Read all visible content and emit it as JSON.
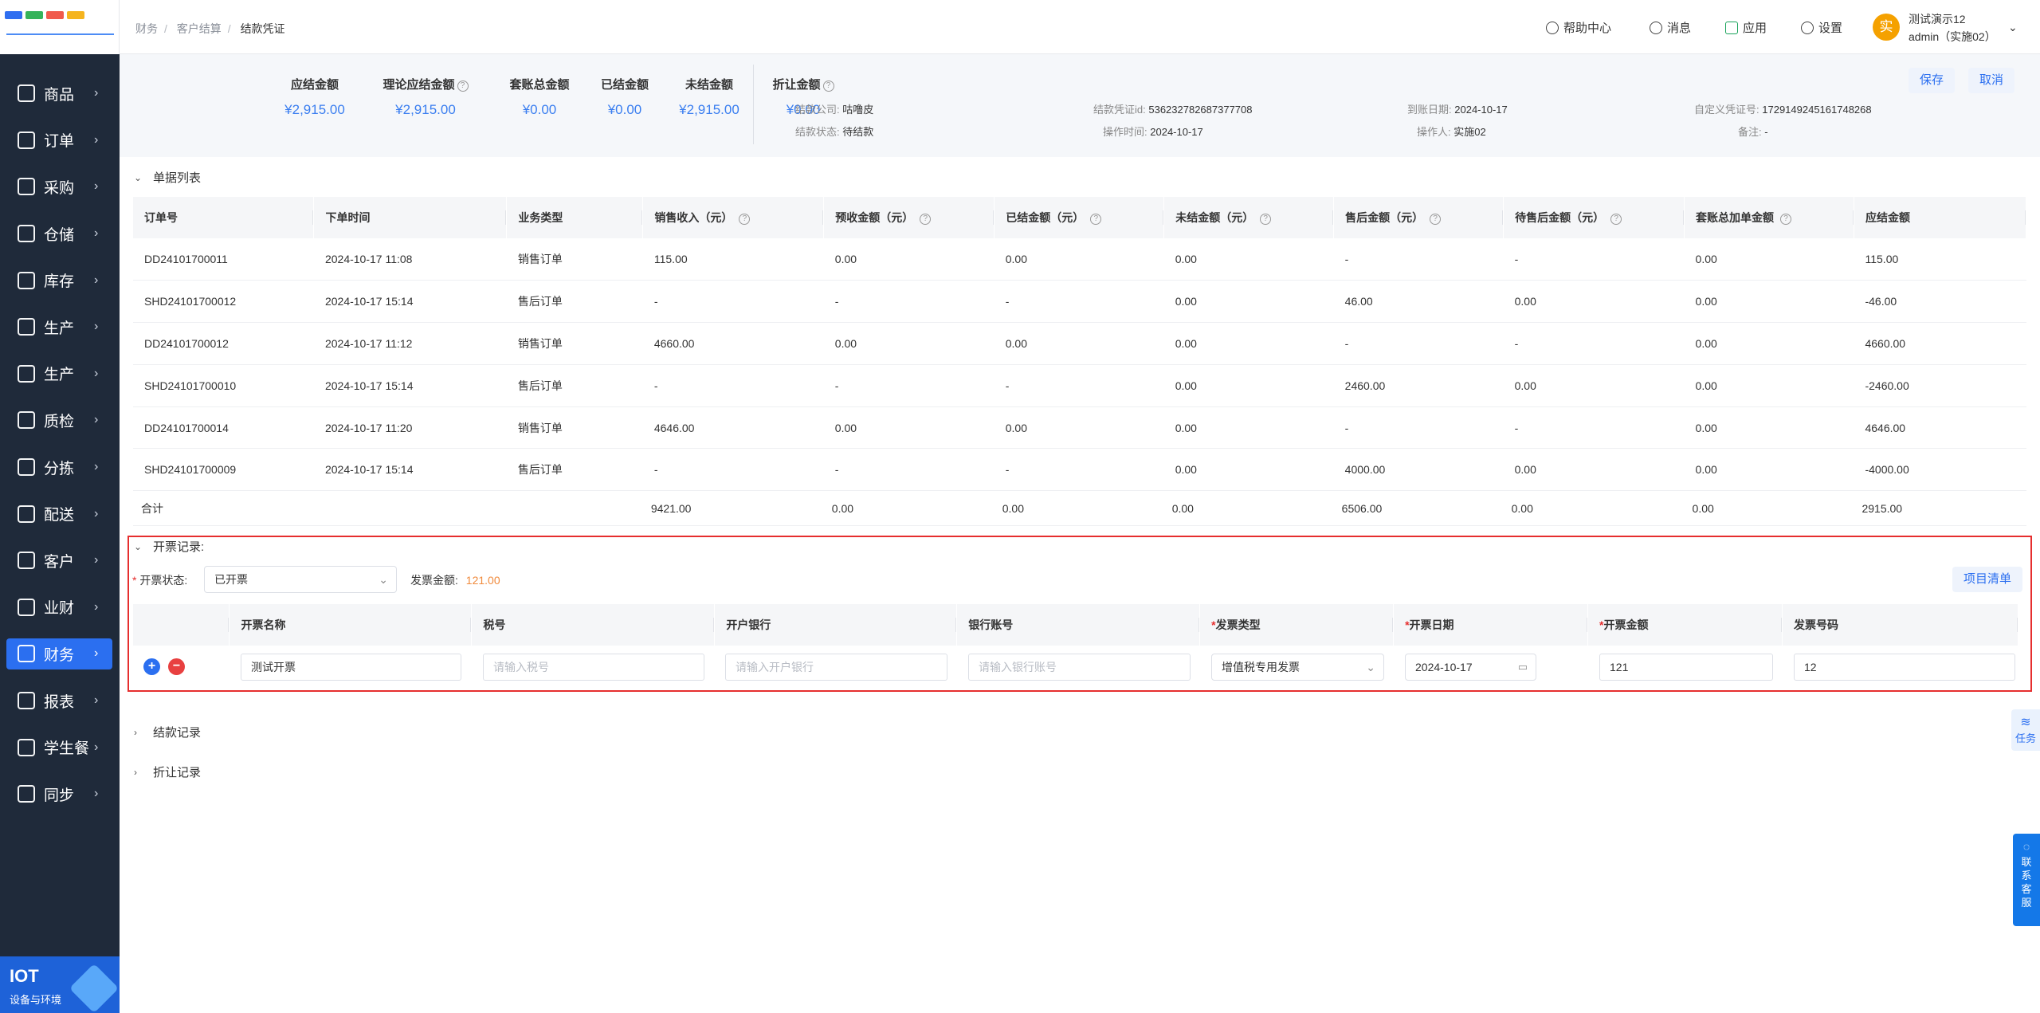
{
  "sidebar": {
    "logo_colors": [
      "#2f6ef0",
      "#35b35a",
      "#f05a4c",
      "#f5b41e"
    ],
    "items": [
      {
        "label": "商品",
        "icon": "goods-icon"
      },
      {
        "label": "订单",
        "icon": "order-icon"
      },
      {
        "label": "采购",
        "icon": "purchase-icon"
      },
      {
        "label": "仓储",
        "icon": "warehouse-icon"
      },
      {
        "label": "库存",
        "icon": "inventory-icon"
      },
      {
        "label": "生产",
        "icon": "production-icon"
      },
      {
        "label": "生产",
        "icon": "production-icon"
      },
      {
        "label": "质检",
        "icon": "shield-icon"
      },
      {
        "label": "分拣",
        "icon": "sorting-icon"
      },
      {
        "label": "配送",
        "icon": "truck-icon"
      },
      {
        "label": "客户",
        "icon": "customer-icon"
      },
      {
        "label": "业财",
        "icon": "chart-icon"
      },
      {
        "label": "财务",
        "icon": "finance-icon",
        "active": true
      },
      {
        "label": "报表",
        "icon": "report-icon"
      },
      {
        "label": "学生餐",
        "icon": "meal-icon"
      },
      {
        "label": "同步",
        "icon": "sync-icon"
      }
    ],
    "brand_title": "IOT",
    "brand_subtitle": "设备与环境"
  },
  "header": {
    "breadcrumb": [
      "财务",
      "客户结算",
      "结款凭证"
    ],
    "help": "帮助中心",
    "messages": "消息",
    "apps": "应用",
    "settings": "设置",
    "avatar_char": "实",
    "user_name": "测试演示12",
    "user_account": "admin（实施02）"
  },
  "summary": {
    "stats": [
      {
        "label": "应结金额",
        "value": "¥2,915.00",
        "help": false
      },
      {
        "label": "理论应结金额",
        "value": "¥2,915.00",
        "help": true
      },
      {
        "label": "套账总金额",
        "value": "¥0.00",
        "help": false
      },
      {
        "label": "已结金额",
        "value": "¥0.00",
        "help": false
      },
      {
        "label": "未结金额",
        "value": "¥2,915.00",
        "help": false
      },
      {
        "label": "折让金额",
        "value": "¥0.00",
        "help": true
      }
    ],
    "info": {
      "company_label": "结款公司:",
      "company": "咕噜皮",
      "status_label": "结款状态:",
      "status": "待结款",
      "voucher_label": "结款凭证id:",
      "voucher": "536232782687377708",
      "optime_label": "操作时间:",
      "optime": "2024-10-17",
      "arrive_label": "到账日期:",
      "arrive": "2024-10-17",
      "operator_label": "操作人:",
      "operator": "实施02",
      "custom_label": "自定义凭证号:",
      "custom": "1729149245161748268",
      "remark_label": "备注:",
      "remark": "-"
    },
    "save": "保存",
    "cancel": "取消"
  },
  "orders": {
    "title": "单据列表",
    "headers": [
      "订单号",
      "下单时间",
      "业务类型",
      "销售收入（元）",
      "预收金额（元）",
      "已结金额（元）",
      "未结金额（元）",
      "售后金额（元）",
      "待售后金额（元）",
      "套账总加单金额",
      "应结金额"
    ],
    "rows": [
      [
        "DD24101700011",
        "2024-10-17 11:08",
        "销售订单",
        "115.00",
        "0.00",
        "0.00",
        "0.00",
        "-",
        "-",
        "0.00",
        "115.00"
      ],
      [
        "SHD24101700012",
        "2024-10-17 15:14",
        "售后订单",
        "-",
        "-",
        "-",
        "0.00",
        "46.00",
        "0.00",
        "0.00",
        "-46.00"
      ],
      [
        "DD24101700012",
        "2024-10-17 11:12",
        "销售订单",
        "4660.00",
        "0.00",
        "0.00",
        "0.00",
        "-",
        "-",
        "0.00",
        "4660.00"
      ],
      [
        "SHD24101700010",
        "2024-10-17 15:14",
        "售后订单",
        "-",
        "-",
        "-",
        "0.00",
        "2460.00",
        "0.00",
        "0.00",
        "-2460.00"
      ],
      [
        "DD24101700014",
        "2024-10-17 11:20",
        "销售订单",
        "4646.00",
        "0.00",
        "0.00",
        "0.00",
        "-",
        "-",
        "0.00",
        "4646.00"
      ],
      [
        "SHD24101700009",
        "2024-10-17 15:14",
        "售后订单",
        "-",
        "-",
        "-",
        "0.00",
        "4000.00",
        "0.00",
        "0.00",
        "-4000.00"
      ]
    ],
    "sum_label": "合计",
    "sum": [
      "9421.00",
      "0.00",
      "0.00",
      "0.00",
      "6506.00",
      "0.00",
      "0.00",
      "2915.00"
    ]
  },
  "invoice": {
    "title": "开票记录:",
    "status_label": "开票状态:",
    "status_value": "已开票",
    "amount_label": "发票金额:",
    "amount_value": "121.00",
    "items_button": "项目清单",
    "headers": [
      "开票名称",
      "税号",
      "开户银行",
      "银行账号",
      "发票类型",
      "开票日期",
      "开票金额",
      "发票号码"
    ],
    "row": {
      "name": "测试开票",
      "tax_placeholder": "请输入税号",
      "bank_placeholder": "请输入开户银行",
      "account_placeholder": "请输入银行账号",
      "type": "增值税专用发票",
      "date": "2024-10-17",
      "amount": "121",
      "number": "12"
    }
  },
  "sections": {
    "settle": "结款记录",
    "discount": "折让记录"
  },
  "floats": {
    "task": "任务",
    "service": [
      "联",
      "系",
      "客",
      "服"
    ]
  }
}
